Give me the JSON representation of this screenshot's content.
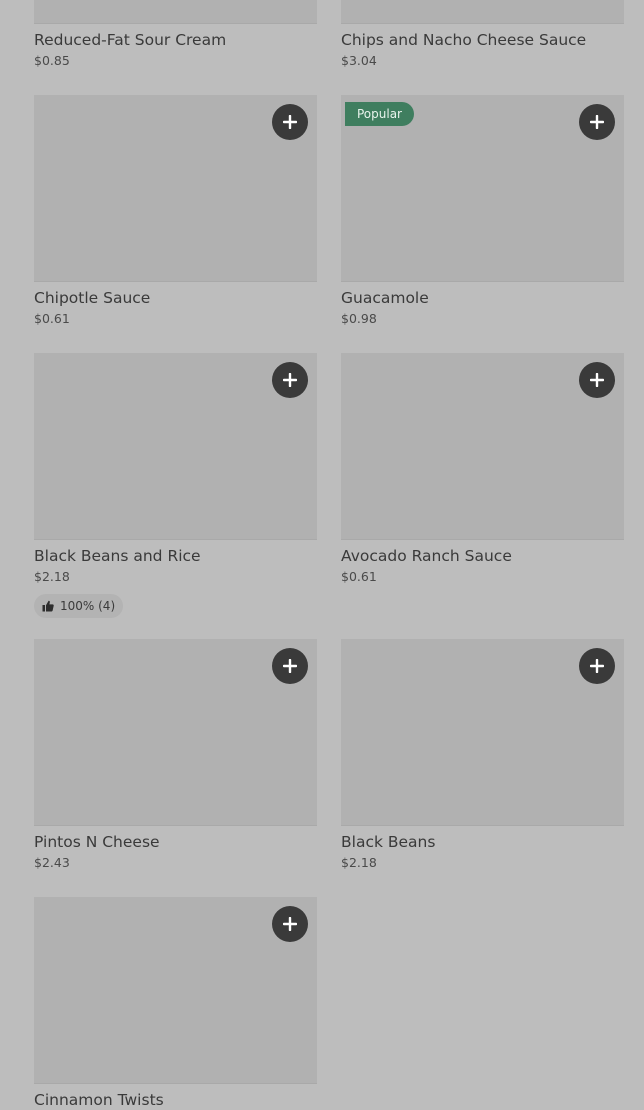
{
  "items": [
    {
      "name": "Reduced-Fat Sour Cream",
      "price": "$0.85"
    },
    {
      "name": "Chips and Nacho Cheese Sauce",
      "price": "$3.04"
    },
    {
      "name": "Chipotle Sauce",
      "price": "$0.61"
    },
    {
      "name": "Guacamole",
      "price": "$0.98",
      "badge": "Popular"
    },
    {
      "name": "Black Beans and Rice",
      "price": "$2.18",
      "rating": "100% (4)"
    },
    {
      "name": "Avocado Ranch Sauce",
      "price": "$0.61"
    },
    {
      "name": "Pintos N Cheese",
      "price": "$2.43"
    },
    {
      "name": "Black Beans",
      "price": "$2.18"
    },
    {
      "name": "Cinnamon Twists",
      "price": ""
    }
  ],
  "icons": {
    "add": "plus-icon",
    "rating": "thumbs-up-icon"
  },
  "colors": {
    "add_button": "#3a3a3a",
    "badge": "#3f7e5f",
    "page_background": "#bdbdbd"
  }
}
